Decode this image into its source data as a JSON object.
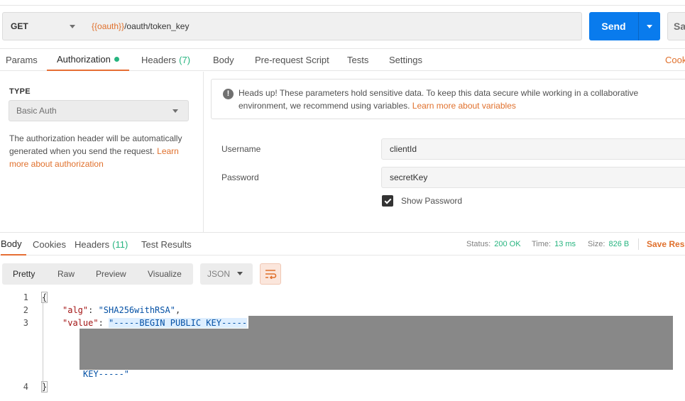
{
  "request": {
    "method": "GET",
    "url_var": "{{oauth}}",
    "url_path": "/oauth/token_key",
    "send_label": "Send",
    "save_label": "Save"
  },
  "req_tabs": [
    {
      "label": "Params"
    },
    {
      "label": "Authorization",
      "active": true,
      "dot": true
    },
    {
      "label": "Headers",
      "count": "(7)"
    },
    {
      "label": "Body"
    },
    {
      "label": "Pre-request Script"
    },
    {
      "label": "Tests"
    },
    {
      "label": "Settings"
    }
  ],
  "cookies_link": "Cookies",
  "auth": {
    "type_label": "TYPE",
    "type_value": "Basic Auth",
    "description": "The authorization header will be automatically generated when you send the request. ",
    "learn_link": "Learn more about authorization",
    "notice_text": "Heads up! These parameters hold sensitive data. To keep this data secure while working in a collaborative environment, we recommend using variables. ",
    "notice_link": "Learn more about variables",
    "username_label": "Username",
    "username_value": "clientId",
    "password_label": "Password",
    "password_value": "secretKey",
    "show_password_label": "Show Password",
    "show_password_checked": true
  },
  "resp_tabs": [
    {
      "label": "Body",
      "active": true
    },
    {
      "label": "Cookies"
    },
    {
      "label": "Headers",
      "count": "(11)"
    },
    {
      "label": "Test Results"
    }
  ],
  "status": {
    "status_label": "Status:",
    "status_value": "200 OK",
    "time_label": "Time:",
    "time_value": "13 ms",
    "size_label": "Size:",
    "size_value": "826 B",
    "save_response": "Save Response"
  },
  "view_modes": [
    "Pretty",
    "Raw",
    "Preview",
    "Visualize"
  ],
  "format": "JSON",
  "code": {
    "line_numbers": [
      "1",
      "2",
      "3",
      "4"
    ],
    "open_brace": "{",
    "alg_key": "\"alg\"",
    "alg_value": "\"SHA256withRSA\"",
    "value_key": "\"value\"",
    "value_start": "\"-----BEGIN PUBLIC KEY-----",
    "value_end": "KEY-----\"",
    "close_brace": "}"
  },
  "colors": {
    "accent": "#e66e34",
    "send": "#097bed",
    "success": "#26b47f"
  }
}
